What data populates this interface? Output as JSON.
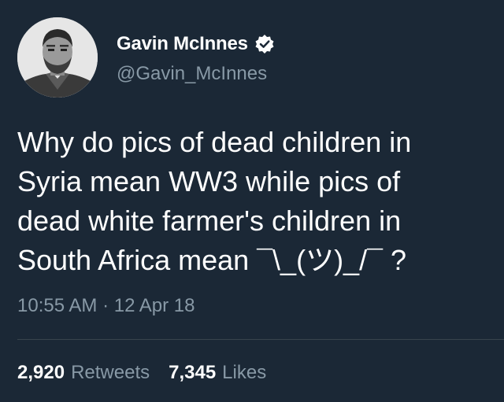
{
  "author": {
    "display_name": "Gavin McInnes",
    "handle": "@Gavin_McInnes",
    "verified_icon": "verified-badge-icon",
    "avatar_icon": "profile-photo"
  },
  "tweet": {
    "text": "Why do pics of dead children in\nSyria mean WW3 while pics of\ndead white farmer's children in\nSouth Africa mean ¯\\_(ツ)_/¯ ?",
    "time": "10:55 AM",
    "separator": "·",
    "date": "12 Apr 18"
  },
  "stats": {
    "retweets_count": "2,920",
    "retweets_label": "Retweets",
    "likes_count": "7,345",
    "likes_label": "Likes"
  },
  "colors": {
    "background": "#1b2836",
    "primary_text": "#ffffff",
    "secondary_text": "#8899a6",
    "divider": "#38444d"
  }
}
